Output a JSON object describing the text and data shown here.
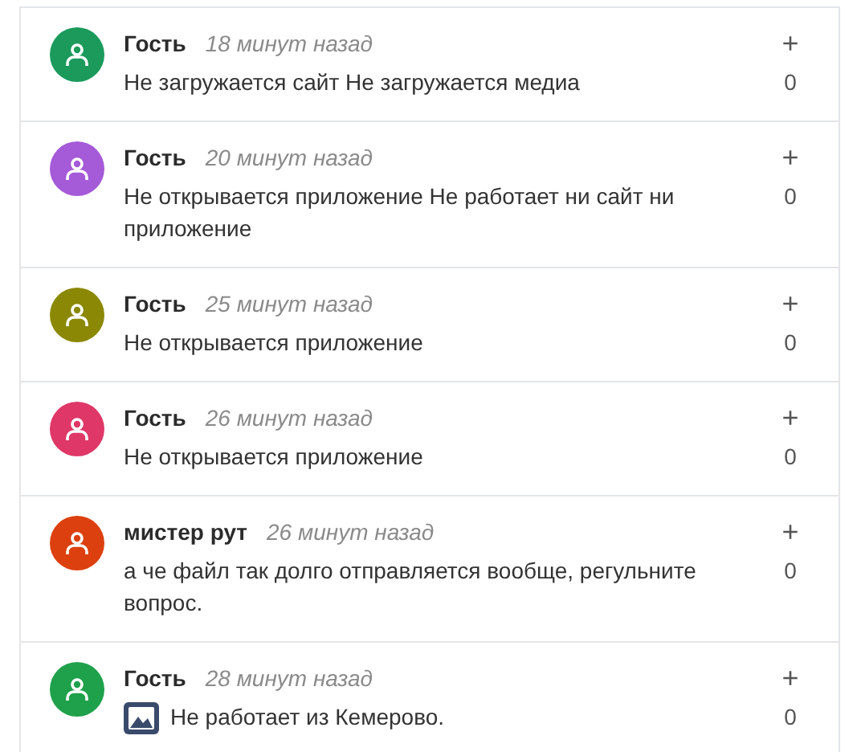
{
  "comments": [
    {
      "author": "Гость",
      "time": "18 минут назад",
      "text": "Не загружается сайт Не загружается медиа",
      "color": "#1b9a5c",
      "has_image": false,
      "vote": "+",
      "score": "0"
    },
    {
      "author": "Гость",
      "time": "20 минут назад",
      "text": "Не открывается приложение Не работает ни сайт ни приложение",
      "color": "#a55ad8",
      "has_image": false,
      "vote": "+",
      "score": "0"
    },
    {
      "author": "Гость",
      "time": "25 минут назад",
      "text": "Не открывается приложение",
      "color": "#8b8806",
      "has_image": false,
      "vote": "+",
      "score": "0"
    },
    {
      "author": "Гость",
      "time": "26 минут назад",
      "text": "Не открывается приложение",
      "color": "#df3768",
      "has_image": false,
      "vote": "+",
      "score": "0"
    },
    {
      "author": "мистер рут",
      "time": "26 минут назад",
      "text": "а че файл так долго отправляется вообще, регульните вопрос.",
      "color": "#dc400e",
      "has_image": false,
      "vote": "+",
      "score": "0"
    },
    {
      "author": "Гость",
      "time": "28 минут назад",
      "text": "Не работает из Кемерово.",
      "color": "#1fa14b",
      "has_image": true,
      "vote": "+",
      "score": "0"
    }
  ]
}
